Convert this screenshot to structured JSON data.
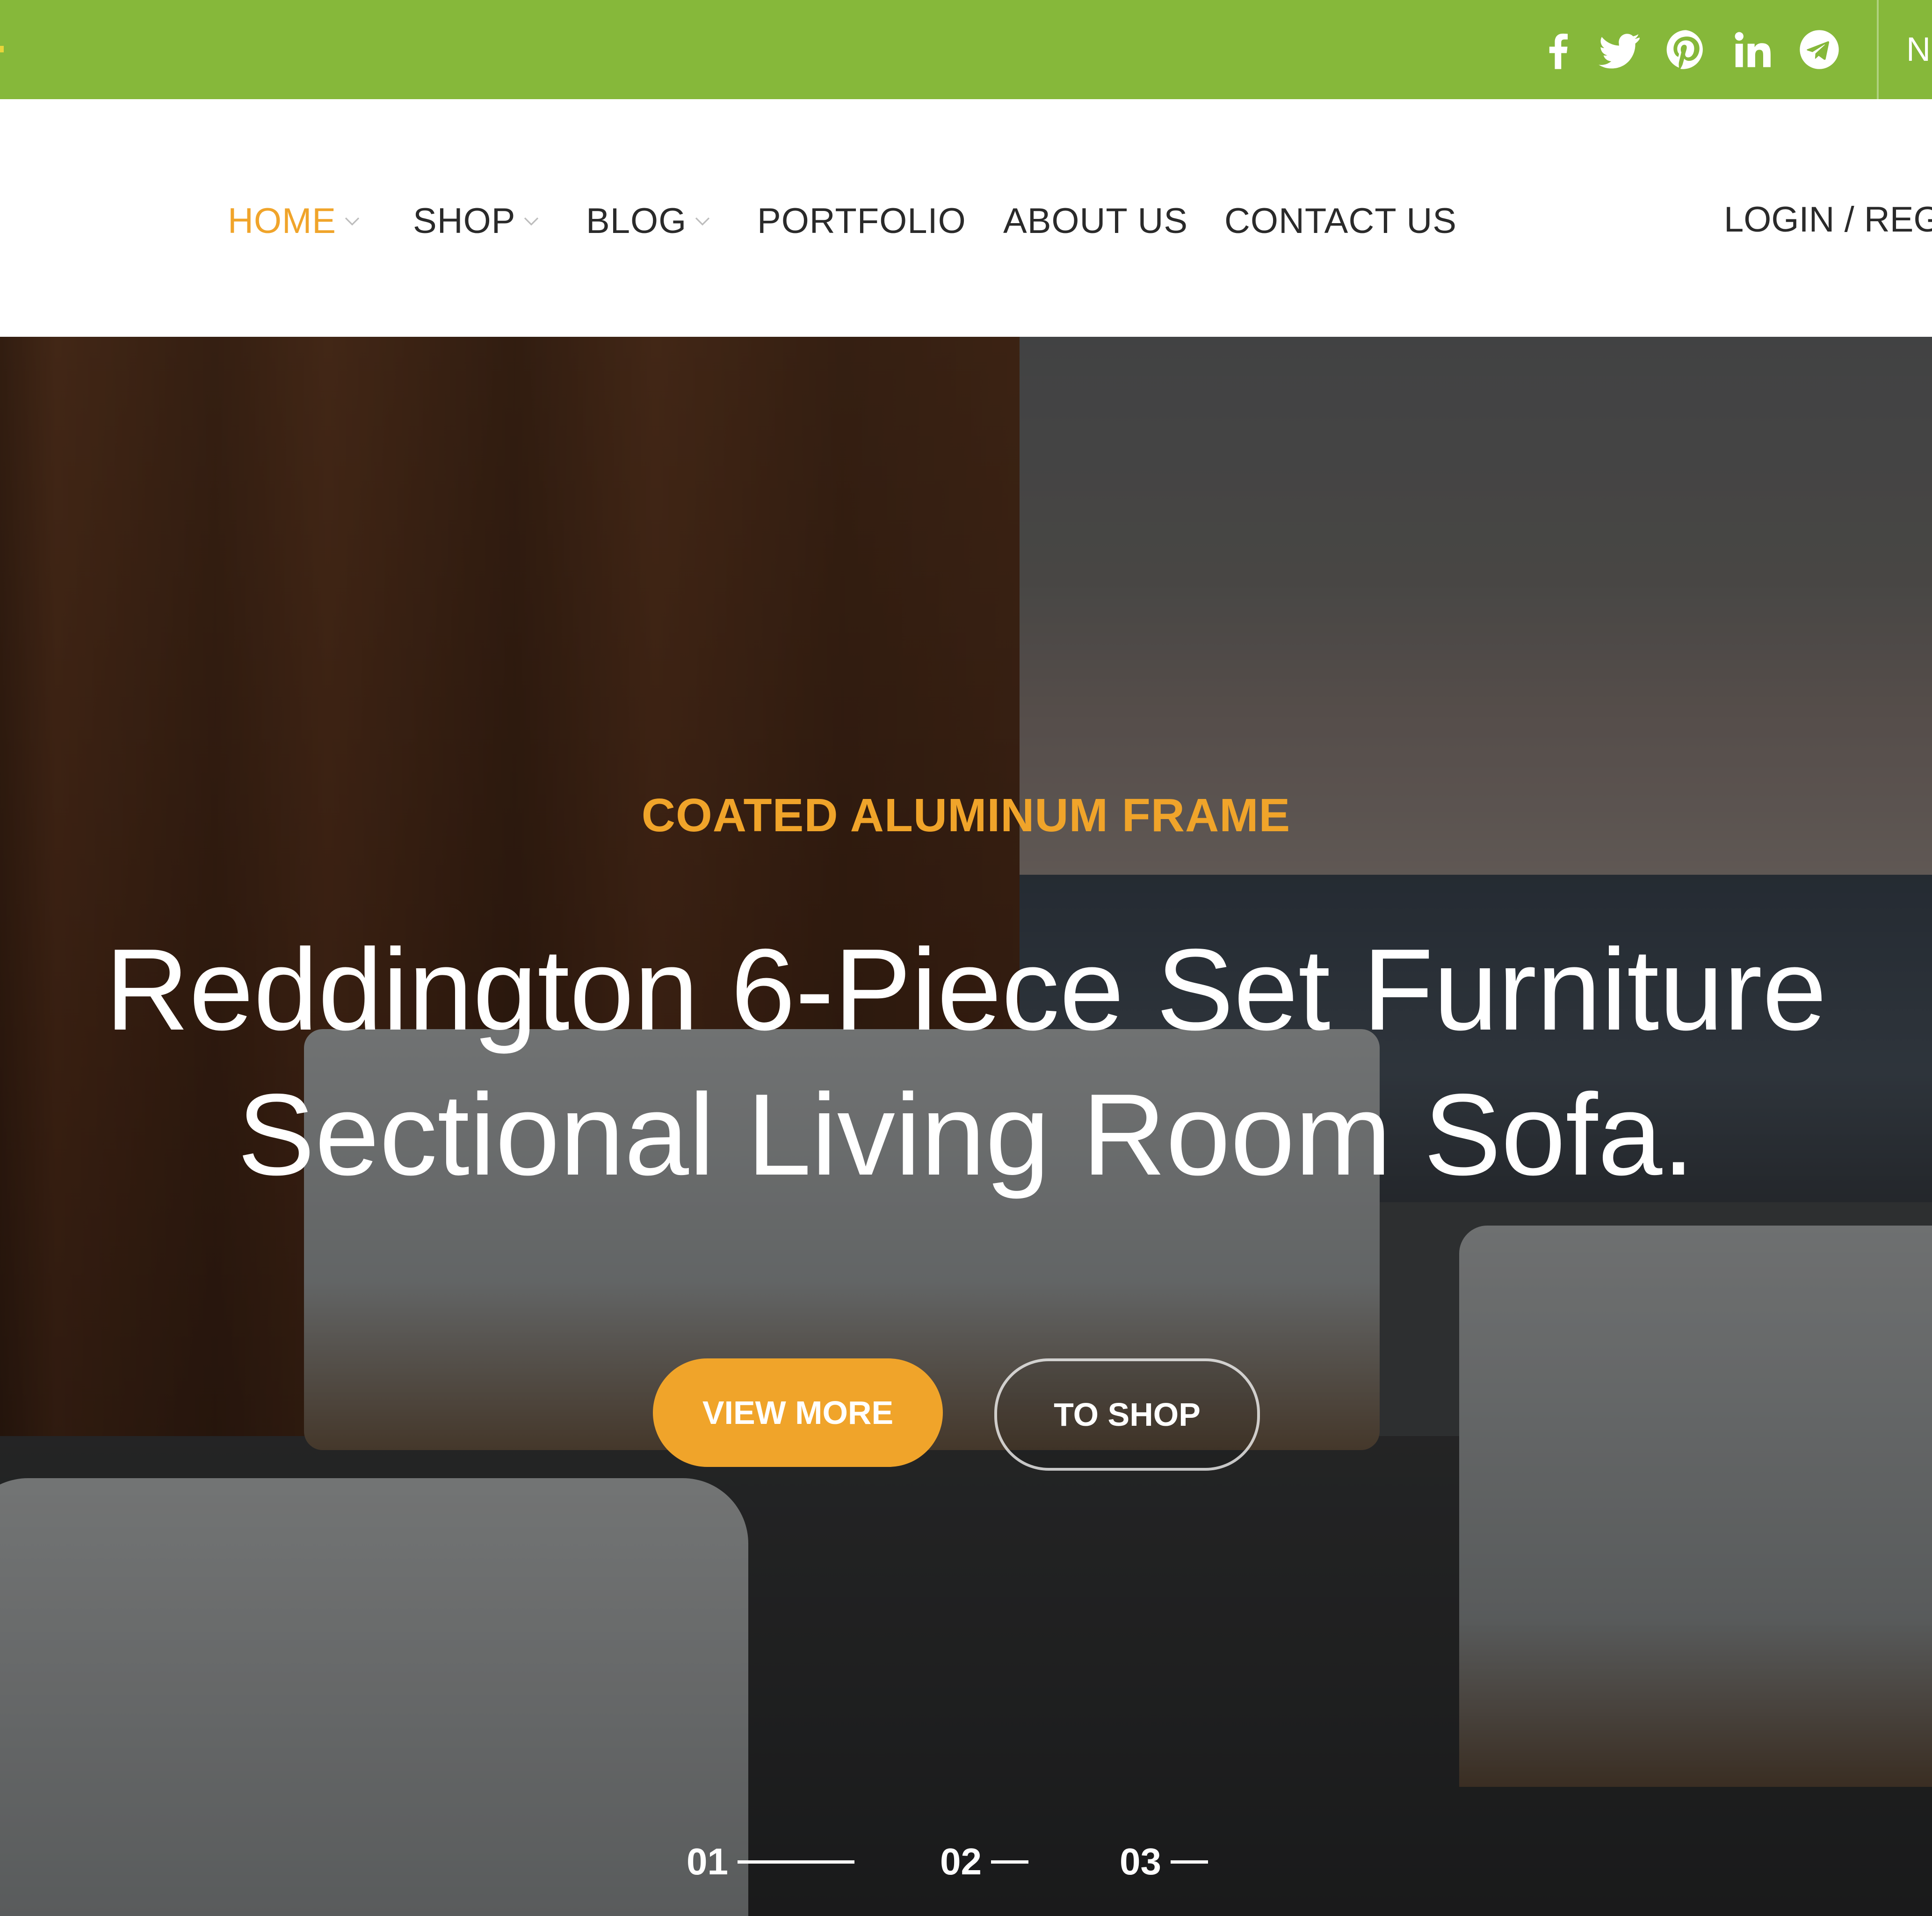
{
  "topbar": {
    "background_color": "#86b83a",
    "social_icons": [
      "facebook-icon",
      "twitter-icon",
      "pinterest-icon",
      "linkedin-icon",
      "telegram-icon"
    ],
    "right_text_cut": "N"
  },
  "nav": {
    "items": [
      {
        "label": "HOME",
        "active": true,
        "has_dropdown": true
      },
      {
        "label": "SHOP",
        "active": false,
        "has_dropdown": true
      },
      {
        "label": "BLOG",
        "active": false,
        "has_dropdown": true
      },
      {
        "label": "PORTFOLIO",
        "active": false,
        "has_dropdown": false
      },
      {
        "label": "ABOUT US",
        "active": false,
        "has_dropdown": false
      },
      {
        "label": "CONTACT US",
        "active": false,
        "has_dropdown": false
      }
    ],
    "active_color": "#f0a42a",
    "login_label": "LOGIN / REGI"
  },
  "hero": {
    "subtitle": "COATED ALUMINUM FRAME",
    "title_line1": "Reddington 6-Piece Set Furniture",
    "title_line2": "Sectional Living Room Sofa.",
    "primary_button": "VIEW MORE",
    "secondary_button": "TO SHOP",
    "accent_color": "#f0a42a",
    "slides": [
      {
        "number": "01",
        "active": true
      },
      {
        "number": "02",
        "active": false
      },
      {
        "number": "03",
        "active": false
      }
    ]
  }
}
